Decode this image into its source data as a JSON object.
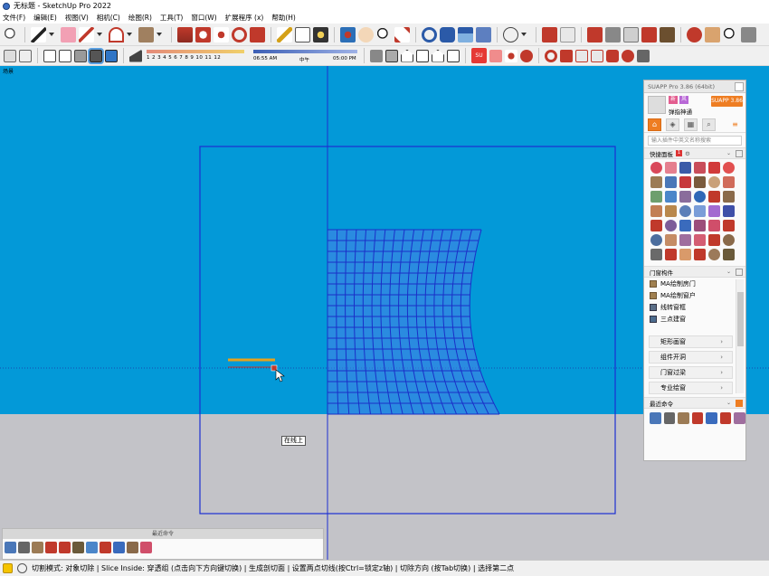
{
  "window": {
    "title": "无标题 - SketchUp Pro 2022"
  },
  "menu": [
    "文件(F)",
    "编辑(E)",
    "视图(V)",
    "相机(C)",
    "绘图(R)",
    "工具(T)",
    "窗口(W)",
    "扩展程序 (x)",
    "帮助(H)"
  ],
  "shadow": {
    "months": "1  2  3  4  5  6  7  8  9  10 11 12",
    "time_start": "06:55 AM",
    "time_mid": "中午",
    "time_end": "05:00 PM"
  },
  "scene_label": "场景",
  "viewport": {
    "tooltip": "在线上",
    "sky_color": "#0399d8",
    "ground_color": "#c3c3c8",
    "section_color": "#1c2fd1",
    "mesh_color": "#1a2fc8"
  },
  "suapp": {
    "title": "SUAPP Pro 3.86 (64bit)",
    "user_name": "弹指神通",
    "badge_a": "新",
    "badge_b": "风",
    "version_button": "SUAPP 3.86",
    "search_placeholder": "输入插件中英文名称搜索",
    "quick_panel_label": "快捷面板",
    "quick_panel_badge": "1",
    "door_section_label": "门窗构件",
    "door_items": [
      "MA绘制房门",
      "MA绘制窗户",
      "线转窗框",
      "三点建窗"
    ],
    "sub_buttons": [
      "矩形画窗",
      "组件开洞",
      "门窗过梁",
      "专业绘窗"
    ],
    "recent_label": "最近命令"
  },
  "recent_bar": {
    "title": "最近命令"
  },
  "status": {
    "text": "切割模式: 对象切除 | Slice Inside: 穿透组 (点击向下方向键切换) | 生成剖切面 | 设置两点切线(按Ctrl=锁定z轴) | 切除方向 (按Tab切换) | 选择第二点"
  }
}
